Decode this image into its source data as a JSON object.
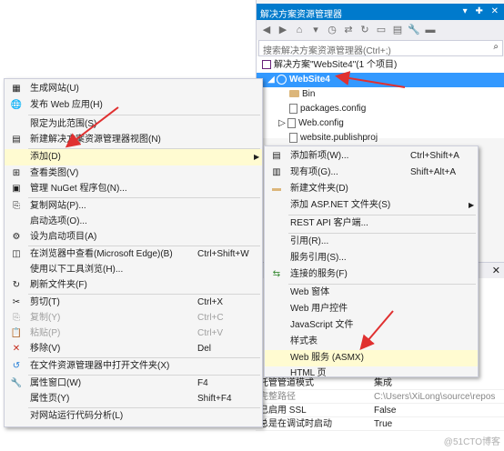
{
  "solution_explorer": {
    "title": "解决方案资源管理器",
    "title_buttons": "▾ ✚ ✕",
    "search_placeholder": "搜索解决方案资源管理器(Ctrl+;)",
    "tree": [
      {
        "label": "解决方案\"WebSite4\"(1 个项目)",
        "icon": "solution-icon"
      },
      {
        "label": "WebSite4",
        "icon": "globe-icon",
        "selected": true
      },
      {
        "label": "Bin",
        "icon": "folder-icon"
      },
      {
        "label": "packages.config",
        "icon": "config-file-icon"
      },
      {
        "label": "Web.config",
        "icon": "config-file-icon"
      },
      {
        "label": "website.publishproj",
        "icon": "file-icon"
      }
    ]
  },
  "properties": {
    "close": "✕",
    "rows": [
      {
        "name": "托管管道模式",
        "value": "集成"
      },
      {
        "name": "完整路径",
        "value": "C:\\Users\\XiLong\\source\\repos",
        "gray": true
      },
      {
        "name": "已启用 SSL",
        "value": "False"
      },
      {
        "name": "总是在调试时启动",
        "value": "True"
      }
    ],
    "watermark": "@51CTO博客"
  },
  "context_menu": {
    "items": [
      {
        "label": "生成网站(U)",
        "icon": "build-icon",
        "glyph": "▦"
      },
      {
        "label": "发布 Web 应用(H)",
        "icon": "globe-icon",
        "glyph": "🌐"
      },
      {
        "label": "限定为此范围(S)",
        "icon": "",
        "glyph": ""
      },
      {
        "label": "新建解决方案资源管理器视图(N)",
        "icon": "new-view-icon",
        "glyph": "▤"
      },
      {
        "label": "添加(D)",
        "icon": "",
        "glyph": "",
        "highlight": true,
        "submenu": true
      },
      {
        "label": "查看类图(V)",
        "icon": "class-diagram-icon",
        "glyph": "⊞"
      },
      {
        "label": "管理 NuGet 程序包(N)...",
        "icon": "nuget-icon",
        "glyph": "▣"
      },
      {
        "label": "复制网站(P)...",
        "icon": "copy-site-icon",
        "glyph": "⎘"
      },
      {
        "label": "启动选项(O)...",
        "icon": "",
        "glyph": ""
      },
      {
        "label": "设为启动项目(A)",
        "icon": "gear-icon",
        "glyph": "⚙"
      },
      {
        "label": "在浏览器中查看(Microsoft Edge)(B)",
        "shortcut": "Ctrl+Shift+W",
        "icon": "browser-icon",
        "glyph": "◫"
      },
      {
        "label": "使用以下工具浏览(H)...",
        "icon": "",
        "glyph": ""
      },
      {
        "label": "刷新文件夹(F)",
        "icon": "refresh-icon",
        "glyph": "↻"
      },
      {
        "label": "剪切(T)",
        "shortcut": "Ctrl+X",
        "icon": "cut-icon",
        "glyph": "✂"
      },
      {
        "label": "复制(Y)",
        "shortcut": "Ctrl+C",
        "icon": "copy-icon",
        "glyph": "⎘",
        "disabled": true
      },
      {
        "label": "粘贴(P)",
        "shortcut": "Ctrl+V",
        "icon": "paste-icon",
        "glyph": "📋",
        "disabled": true
      },
      {
        "label": "移除(V)",
        "shortcut": "Del",
        "icon": "remove-icon",
        "glyph": "✕"
      },
      {
        "label": "在文件资源管理器中打开文件夹(X)",
        "icon": "open-folder-icon",
        "glyph": "↺"
      },
      {
        "label": "属性窗口(W)",
        "shortcut": "F4",
        "icon": "wrench-icon",
        "glyph": "🔧"
      },
      {
        "label": "属性页(Y)",
        "shortcut": "Shift+F4",
        "icon": "",
        "glyph": ""
      },
      {
        "label": "对网站运行代码分析(L)",
        "icon": "",
        "glyph": ""
      }
    ]
  },
  "submenu": {
    "items": [
      {
        "label": "添加新项(W)...",
        "shortcut": "Ctrl+Shift+A",
        "icon": "new-item-icon",
        "glyph": "▤"
      },
      {
        "label": "现有项(G)...",
        "shortcut": "Shift+Alt+A",
        "icon": "existing-item-icon",
        "glyph": "▥"
      },
      {
        "label": "新建文件夹(D)",
        "icon": "new-folder-icon",
        "glyph": "▬"
      },
      {
        "label": "添加 ASP.NET 文件夹(S)",
        "icon": "",
        "glyph": "",
        "submenu": true
      },
      {
        "label": "REST API 客户端...",
        "icon": "",
        "glyph": ""
      },
      {
        "label": "引用(R)...",
        "icon": "",
        "glyph": ""
      },
      {
        "label": "服务引用(S)...",
        "icon": "",
        "glyph": ""
      },
      {
        "label": "连接的服务(F)",
        "icon": "connected-service-icon",
        "glyph": "⇆"
      },
      {
        "label": "Web 窗体",
        "icon": "",
        "glyph": ""
      },
      {
        "label": "Web 用户控件",
        "icon": "",
        "glyph": ""
      },
      {
        "label": "JavaScript 文件",
        "icon": "",
        "glyph": ""
      },
      {
        "label": "样式表",
        "icon": "",
        "glyph": ""
      },
      {
        "label": "Web 服务 (ASMX)",
        "icon": "",
        "glyph": "",
        "highlight": true
      },
      {
        "label": "HTML 页",
        "icon": "",
        "glyph": ""
      }
    ]
  },
  "colors": {
    "accent": "#007acc",
    "selection": "#3399ff",
    "menu_highlight": "#fffbd1",
    "annotation_arrow": "#e03030"
  }
}
